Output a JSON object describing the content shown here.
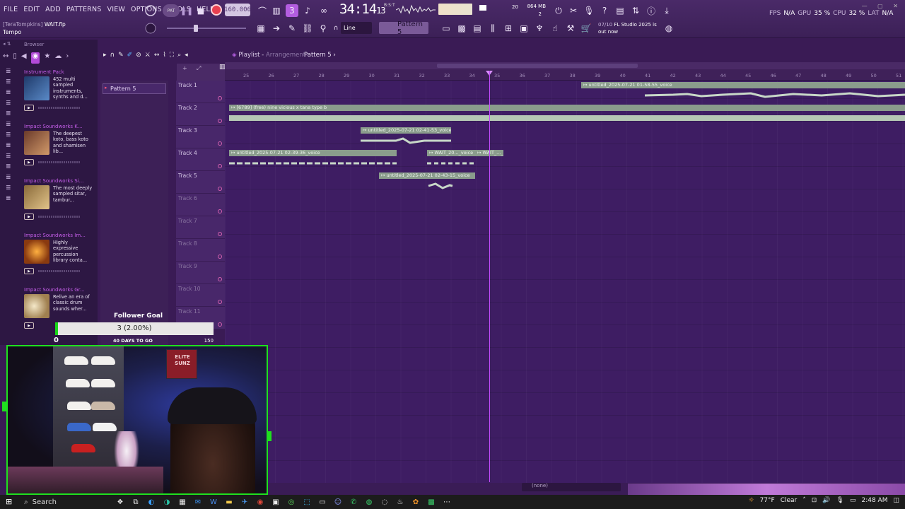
{
  "menu": [
    "FILE",
    "EDIT",
    "ADD",
    "PATTERNS",
    "VIEW",
    "OPTIONS",
    "TOOLS",
    "HELP"
  ],
  "project": {
    "user": "[TeraTompkins]",
    "file": "WAIT.flp",
    "hint": "Tempo"
  },
  "transport": {
    "pat_label": "PAT",
    "bpm": "160.006",
    "time": "34:14",
    "time_sub": "13",
    "time_label": "B:S:T"
  },
  "system": {
    "memory": "864 MB",
    "polyphony": "2",
    "cpu_num": "20"
  },
  "toolbar": {
    "snap_mode": "Line",
    "pattern": "Pattern 5"
  },
  "news": {
    "date": "07/10",
    "text": "FL Studio 2025 is",
    "text2": "out now"
  },
  "stats": {
    "fps_label": "FPS",
    "fps": "N/A",
    "gpu_label": "GPU",
    "gpu": "35 %",
    "cpu_label": "CPU",
    "cpu": "32 %",
    "lat_label": "LAT",
    "lat": "N/A"
  },
  "browser": {
    "title": "Browser",
    "packs": [
      {
        "title": "Instrument Pack",
        "desc": "452 multi sampled instruments, synths and d..."
      },
      {
        "title": "Impact Soundworks K...",
        "desc": "The deepest koto, bass koto and shamisen lib..."
      },
      {
        "title": "Impact Soundworks Si...",
        "desc": "The most deeply sampled sitar, tambur..."
      },
      {
        "title": "Impact Soundworks Im...",
        "desc": "Highly expressive percussion library conta..."
      },
      {
        "title": "Impact Soundworks Gr...",
        "desc": "Relive an era of classic drum sounds wher..."
      }
    ]
  },
  "playlist": {
    "title": "Playlist",
    "subtitle": "Arrangement",
    "pattern": "Pattern 5",
    "pattern_item": "Pattern 5",
    "ruler": [
      "25",
      "26",
      "27",
      "28",
      "29",
      "30",
      "31",
      "32",
      "33",
      "34",
      "35",
      "36",
      "37",
      "38",
      "39",
      "40",
      "41",
      "42",
      "43",
      "44",
      "45",
      "46",
      "47",
      "48",
      "49",
      "50",
      "51"
    ],
    "tracks": [
      "Track 1",
      "Track 2",
      "Track 3",
      "Track 4",
      "Track 5",
      "Track 6",
      "Track 7",
      "Track 8",
      "Track 9",
      "Track 10",
      "Track 11"
    ],
    "clips": [
      {
        "track": 0,
        "label": "untitled_2025-07-21 01-58-55_voice"
      },
      {
        "track": 1,
        "label": "[6789] (free) nine vicious x tana type b"
      },
      {
        "track": 2,
        "label": "untitled_2025-07-21 02-41-53_voice"
      },
      {
        "track": 3,
        "label": "untitled_2025-07-21 02-39-36_voice"
      },
      {
        "track": 3,
        "label": "WAIT_20..._voice"
      },
      {
        "track": 3,
        "label": "WAIT_..._voice"
      },
      {
        "track": 4,
        "label": "untitled_2025-07-21 02-43-15_voice"
      }
    ],
    "none_label": "(none)"
  },
  "follower_goal": {
    "title": "Follower Goal",
    "value": "3 (2.00%)",
    "min": "0",
    "max": "150",
    "days": "40 DAYS TO GO",
    "progress_fraction": 0.02
  },
  "webcam": {
    "poster_text": "ELITE SUNZ"
  },
  "taskbar": {
    "search": "Search",
    "weather": "77°F",
    "weather_desc": "Clear",
    "time": "2:48 AM"
  }
}
